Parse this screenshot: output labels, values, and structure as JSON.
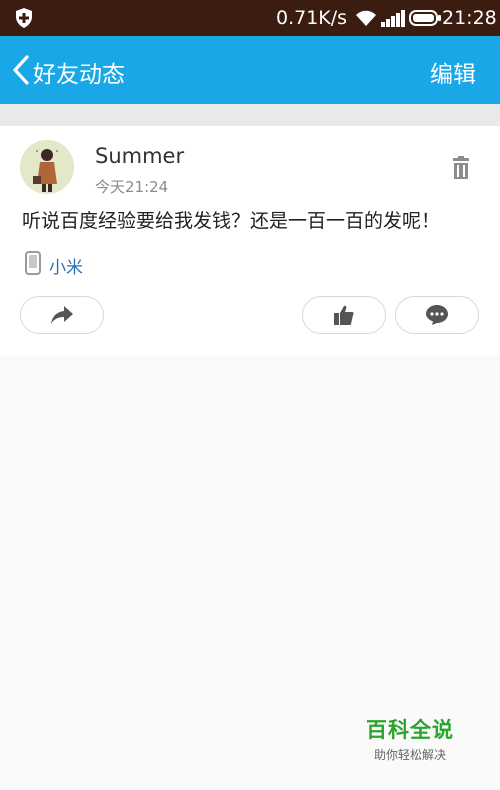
{
  "status_bar": {
    "network_speed": "0.71K/s",
    "time": "21:28",
    "icons": [
      "shield-icon",
      "wifi-icon",
      "signal-icon",
      "battery-icon"
    ]
  },
  "app_bar": {
    "title": "好友动态",
    "edit_label": "编辑",
    "back_icon": "chevron-left-icon",
    "color": "#1aa7e8"
  },
  "post": {
    "username": "Summer",
    "time": "今天21:24",
    "content": "听说百度经验要给我发钱？还是一百一百的发呢！",
    "device": "小米",
    "actions": [
      "share-icon",
      "thumbs-up-icon",
      "comment-icon"
    ]
  },
  "watermark": {
    "title": "百科全说",
    "subtitle": "助你轻松解决"
  }
}
